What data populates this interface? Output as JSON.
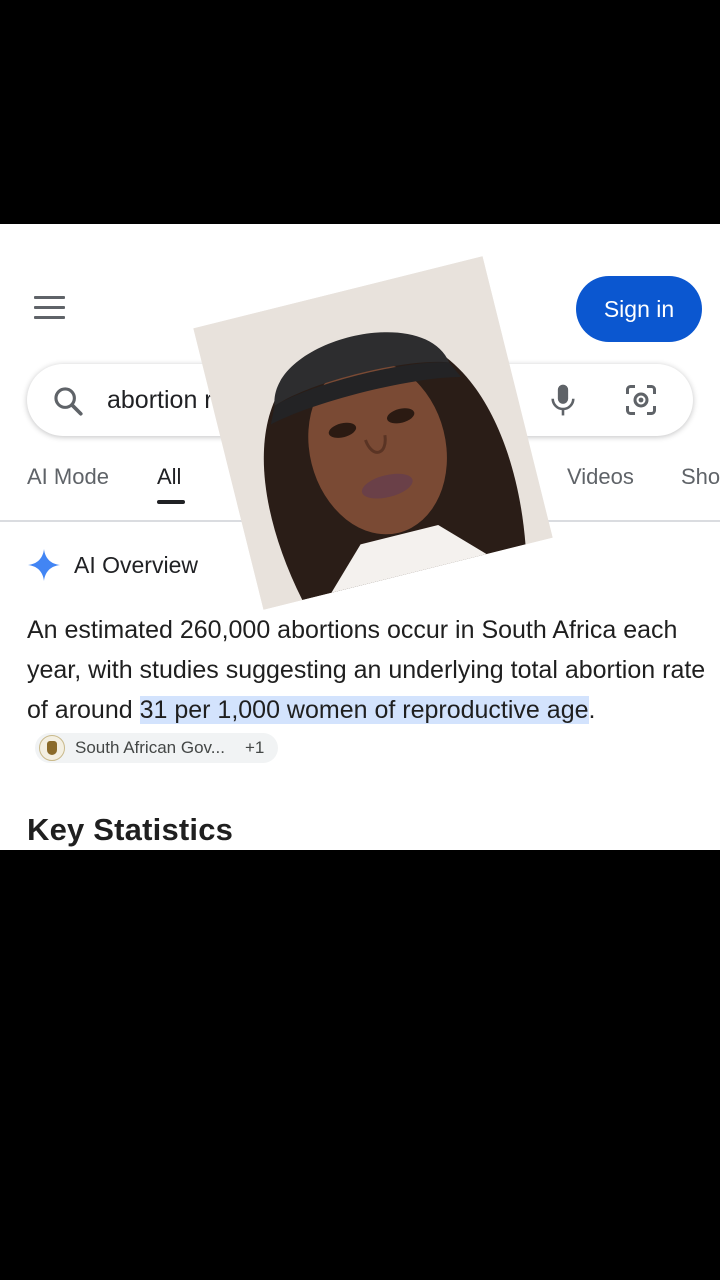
{
  "header": {
    "signin_label": "Sign in"
  },
  "search": {
    "query": "abortion rat",
    "placeholder": ""
  },
  "tabs": [
    {
      "label": "AI Mode"
    },
    {
      "label": "All",
      "active": true
    },
    {
      "label": "Videos"
    },
    {
      "label": "Sho"
    }
  ],
  "ai_overview": {
    "title": "AI Overview",
    "text_before": "An estimated 260,000 abortions occur in South Africa each year, with studies suggesting an underlying total abortion rate of around ",
    "text_highlight": "31 per 1,000 women of reproductive age",
    "text_after": ".",
    "source_chip": {
      "label": "South African Gov...",
      "more": "+1"
    }
  },
  "section_heading": "Key Statistics",
  "colors": {
    "accent": "#0b57d0",
    "highlight": "#d3e3fd",
    "spark": "#4285f4",
    "background": "#000000"
  },
  "icons": [
    "menu-icon",
    "search-icon",
    "mic-icon",
    "lens-icon",
    "sparkle-icon",
    "coat-of-arms-icon"
  ]
}
